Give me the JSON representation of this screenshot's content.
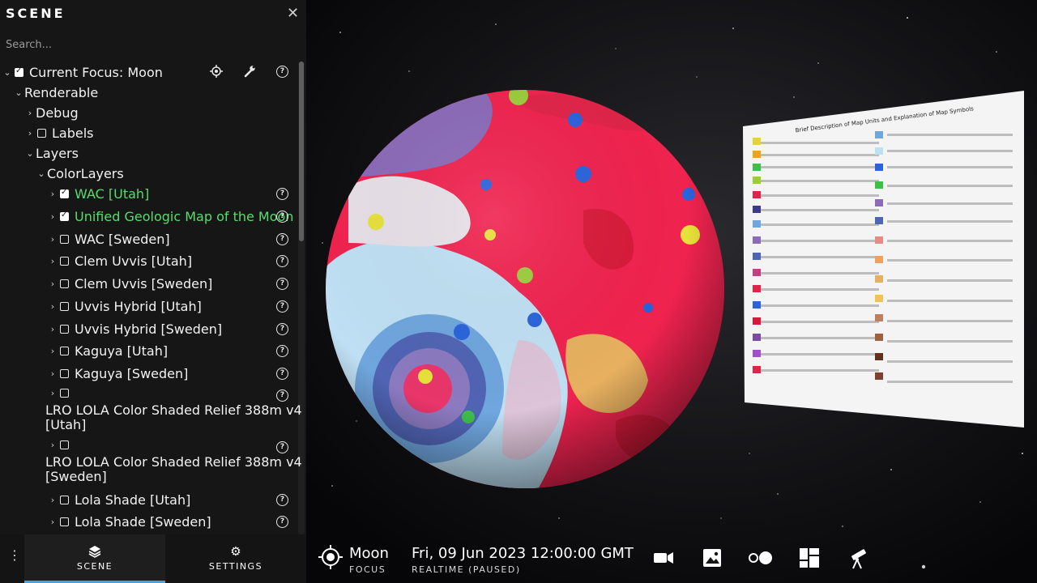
{
  "sidebar": {
    "title": "SCENE",
    "close_icon": "close-icon",
    "search_placeholder": "Search...",
    "focus_label": "Current Focus: Moon",
    "renderable": "Renderable",
    "debug": "Debug",
    "labels": "Labels",
    "layers": "Layers",
    "color_layers": "ColorLayers",
    "layer_items": [
      {
        "label": "WAC [Utah]",
        "checked": true
      },
      {
        "label": "Unified Geologic Map of the Moon",
        "checked": true
      },
      {
        "label": "WAC [Sweden]",
        "checked": false
      },
      {
        "label": "Clem Uvvis [Utah]",
        "checked": false
      },
      {
        "label": "Clem Uvvis [Sweden]",
        "checked": false
      },
      {
        "label": "Uvvis Hybrid [Utah]",
        "checked": false
      },
      {
        "label": "Uvvis Hybrid [Sweden]",
        "checked": false
      },
      {
        "label": "Kaguya [Utah]",
        "checked": false
      },
      {
        "label": "Kaguya [Sweden]",
        "checked": false
      }
    ],
    "lola_utah_line1": "LRO LOLA Color Shaded Relief 388m v4",
    "lola_utah_line2": "[Utah]",
    "lola_sweden_line1": "LRO LOLA Color Shaded Relief 388m v4",
    "lola_sweden_line2": "[Sweden]",
    "lola_shade_utah": "Lola Shade [Utah]",
    "lola_shade_sweden": "Lola Shade [Sweden]",
    "help_glyph": "?"
  },
  "footer_tabs": {
    "scene": "SCENE",
    "settings": "SETTINGS"
  },
  "bottom_bar": {
    "focus_name": "Moon",
    "focus_sub": "FOCUS",
    "time": "Fri, 09 Jun 2023 12:00:00 GMT",
    "time_sub": "REALTIME (PAUSED)"
  },
  "map_panel": {
    "title": "Brief Description of Map Units and Explanation of Map Symbols"
  },
  "colors": {
    "accent_blue": "#44a3e8",
    "enabled_green": "#56dd6e",
    "sidebar_bg": "#161616"
  }
}
